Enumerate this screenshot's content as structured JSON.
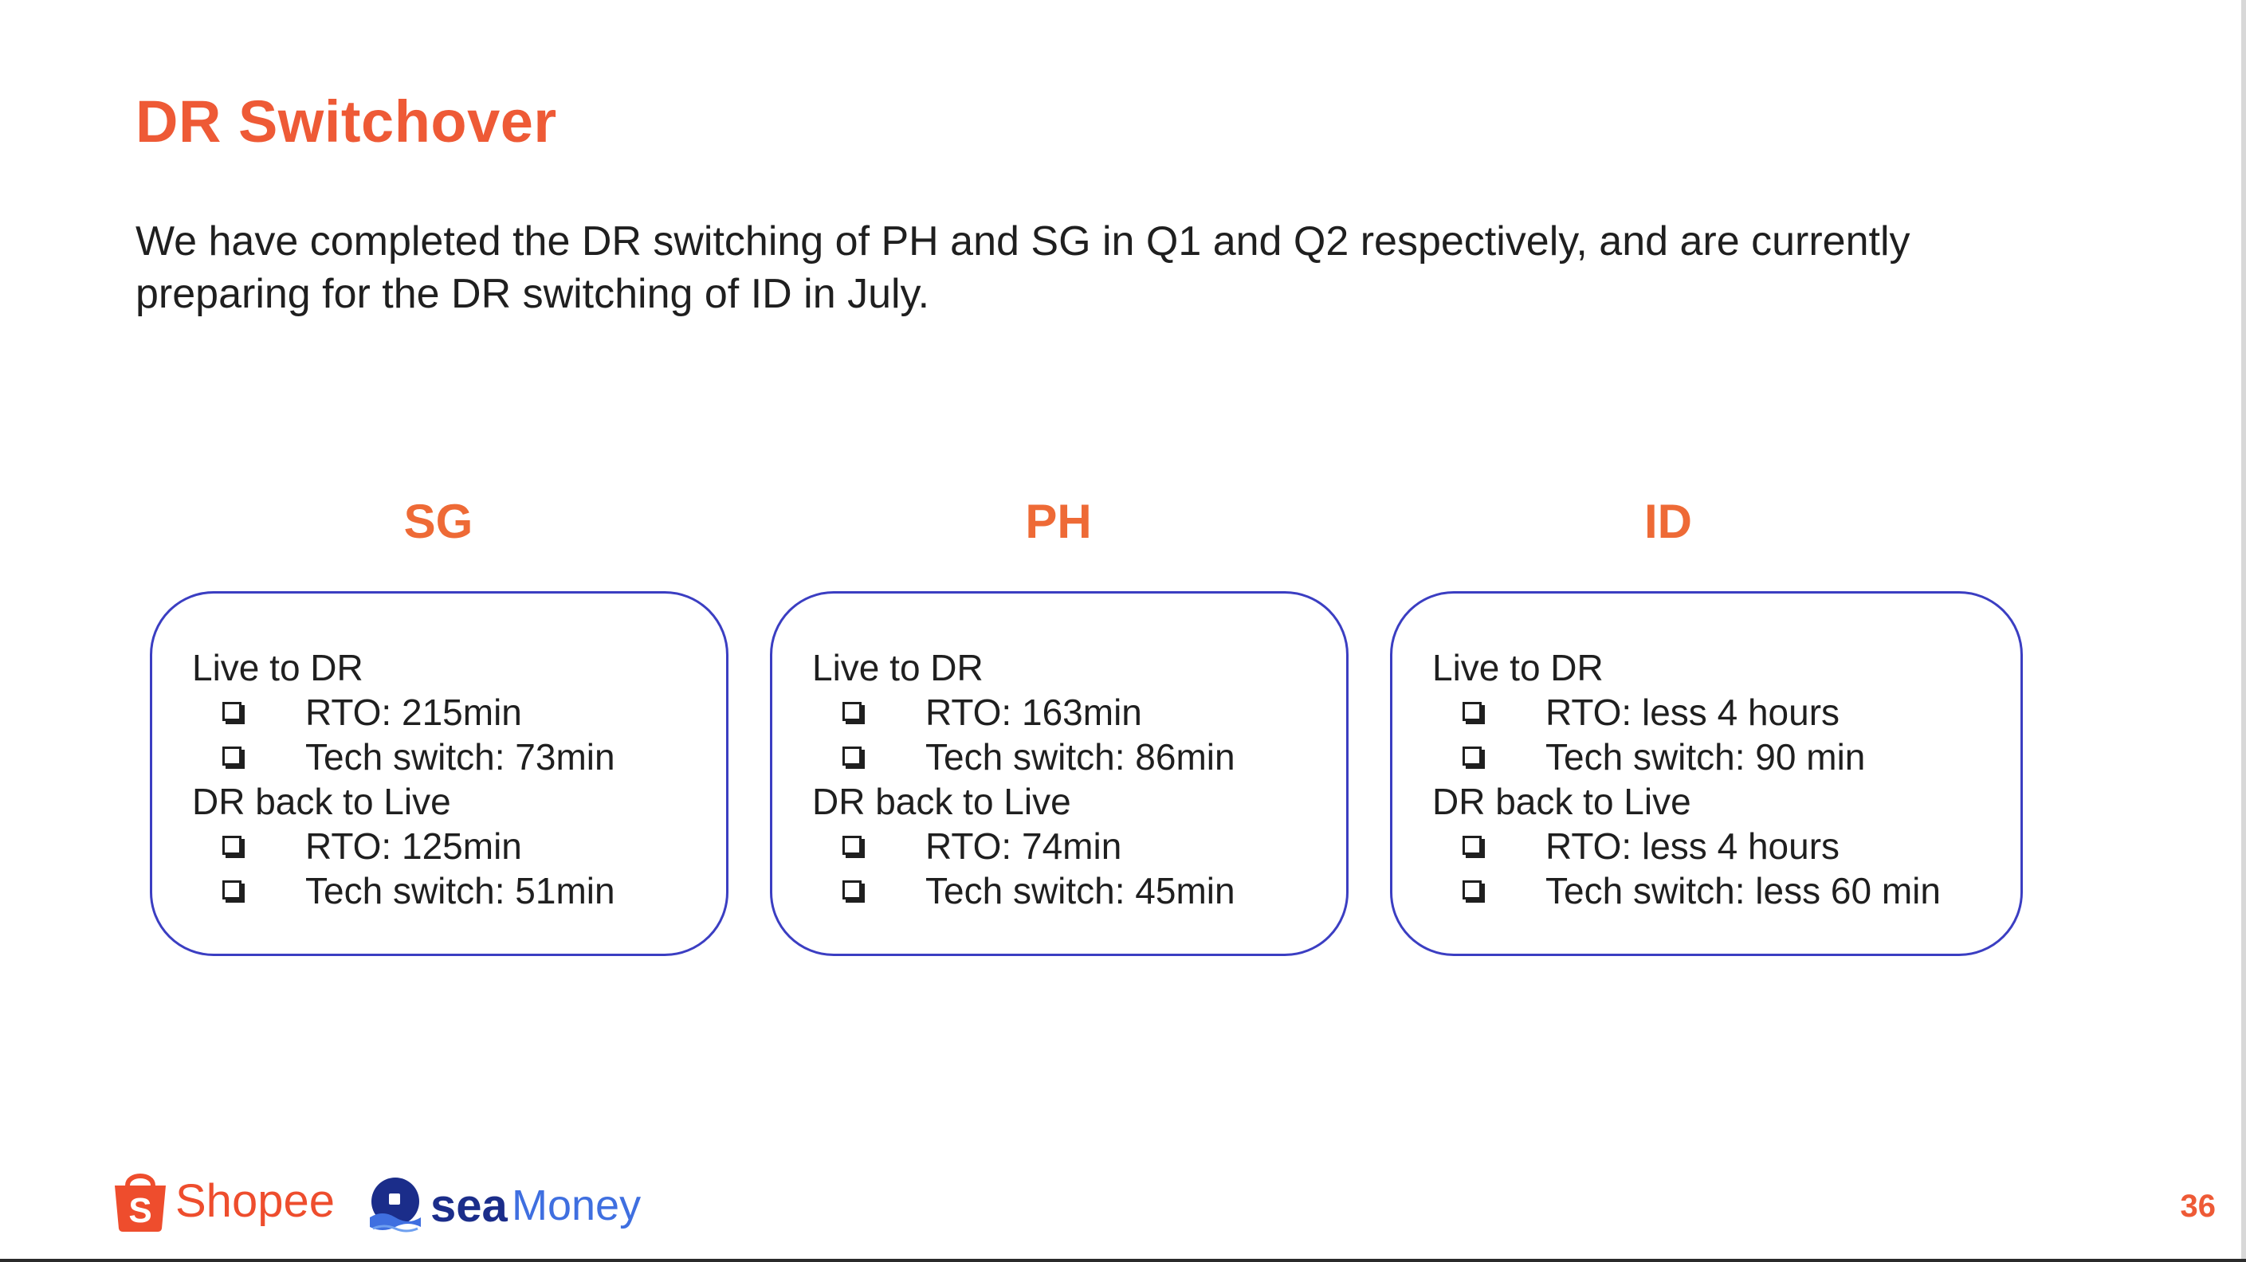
{
  "slide": {
    "title": "DR Switchover",
    "intro": "We have completed the DR switching of PH and SG in Q1 and Q2 respectively, and are currently preparing for the DR switching of ID in July.",
    "page_number": "36"
  },
  "columns": [
    {
      "title": "SG",
      "sections": [
        {
          "title": "Live to DR",
          "items": [
            "RTO: 215min",
            "Tech switch: 73min"
          ]
        },
        {
          "title": "DR back to Live",
          "items": [
            "RTO: 125min",
            "Tech switch: 51min"
          ]
        }
      ]
    },
    {
      "title": "PH",
      "sections": [
        {
          "title": "Live to DR",
          "items": [
            "RTO: 163min",
            "Tech switch: 86min"
          ]
        },
        {
          "title": "DR back to Live",
          "items": [
            "RTO: 74min",
            "Tech switch: 45min"
          ]
        }
      ]
    },
    {
      "title": "ID",
      "sections": [
        {
          "title": "Live to DR",
          "items": [
            "RTO: less 4 hours",
            "Tech switch: 90 min"
          ]
        },
        {
          "title": "DR back to Live",
          "items": [
            "RTO: less 4 hours",
            "Tech switch: less 60 min"
          ]
        }
      ]
    }
  ],
  "footer": {
    "shopee_logo_text": "Shopee",
    "shopee_bag_letter": "S",
    "seamoney_logo_sea": "sea",
    "seamoney_logo_money": "Money"
  },
  "colors": {
    "accent": "#ee5a36",
    "card_border": "#3b3ec2",
    "shopee": "#ee4d2d",
    "seamoney_dark": "#1b2d8a",
    "seamoney_light": "#3f6fe0"
  },
  "icons": {
    "checkbox": "checkbox-icon",
    "shopee": "shopee-bag-icon",
    "seamoney": "seamoney-icon"
  }
}
